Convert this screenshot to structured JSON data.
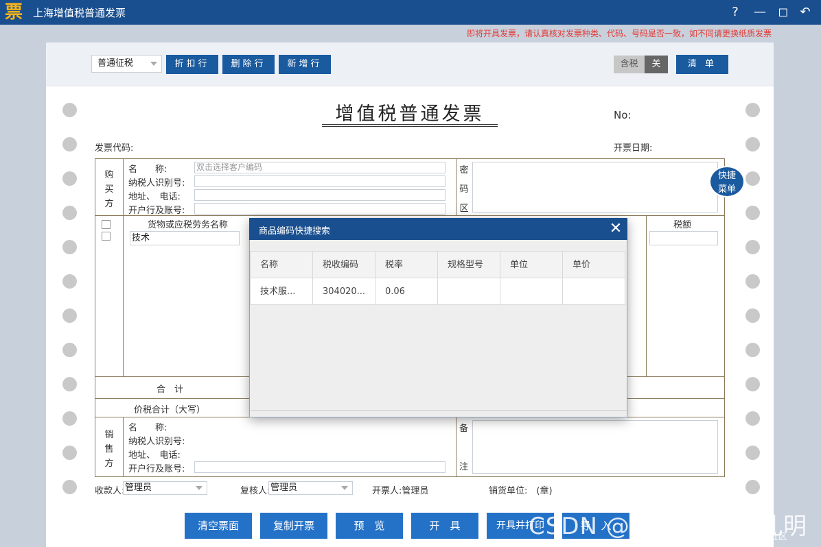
{
  "app": {
    "logo_char": "票",
    "title": "上海增值税普通发票",
    "help": "?",
    "minimize": "—",
    "maximize": "◻",
    "back": "↶"
  },
  "warning": "即将开具发票，请认真核对发票种类、代码、号码是否一致，如不同请更换纸质发票",
  "toolbar": {
    "tax_mode": "普通征税",
    "discount_row": "折扣行",
    "delete_row": "删除行",
    "add_row": "新增行",
    "tax_included_label": "含税",
    "tax_included_state": "关",
    "list": "清 单"
  },
  "invoice": {
    "heading": "增值税普通发票",
    "no_label": "No:",
    "code_label": "发票代码:",
    "date_label": "开票日期:",
    "buyer": {
      "side": [
        "购",
        "买",
        "方"
      ],
      "name_label": "名　　称:",
      "name_placeholder": "双击选择客户编码",
      "taxid_label": "纳税人识别号:",
      "addr_label": "地址、　电话:",
      "bank_label": "开户行及账号:"
    },
    "cipher": [
      "密",
      "码",
      "区"
    ],
    "items": {
      "goods_header": "货物或应税劳务名称",
      "tax_header": "税额",
      "goods_value": "技术"
    },
    "total_label": "合　计",
    "total_words_label": "价税合计（大写）",
    "seller": {
      "side": [
        "销",
        "售",
        "方"
      ],
      "name_label": "名　　称:",
      "taxid_label": "纳税人识别号:",
      "addr_label": "地址、　电话:",
      "bank_label": "开户行及账号:"
    },
    "remark": [
      "备",
      "注"
    ],
    "payee_label": "收款人:",
    "payee_value": "管理员",
    "reviewer_label": "复核人:",
    "reviewer_value": "管理员",
    "drawer_text": "开票人:管理员",
    "seller_unit": "销货单位:　(章)"
  },
  "quick_menu": [
    "快捷",
    "菜单"
  ],
  "bottom_buttons": [
    "清空票面",
    "复制开票",
    "预　览",
    "开　具",
    "开具并打印",
    "导　入"
  ],
  "dialog": {
    "title": "商品编码快捷搜索",
    "close": "✕",
    "columns": [
      "名称",
      "税收编码",
      "税率",
      "规格型号",
      "单位",
      "单价"
    ],
    "rows": [
      [
        "技术服...",
        "304020...",
        "0.06",
        "",
        "",
        ""
      ]
    ]
  },
  "watermark": "CSDN @xyphf_和派孔明",
  "watermark_sub": "@稀土掘金技术社区"
}
